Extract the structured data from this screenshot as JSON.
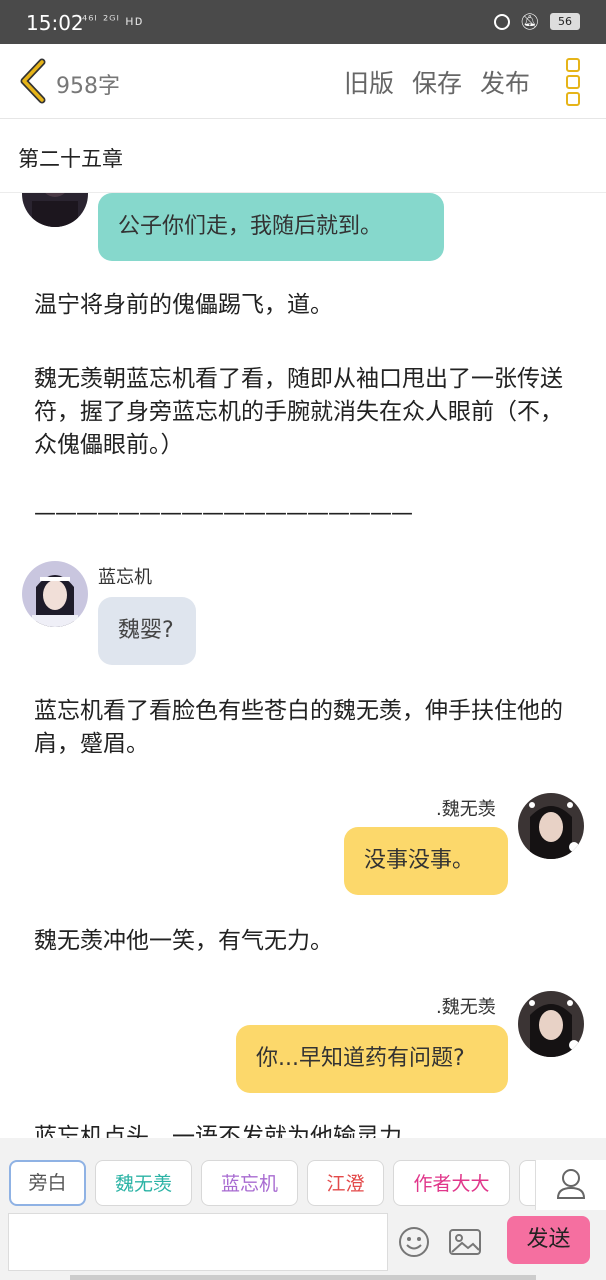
{
  "status_bar": {
    "time": "15:02",
    "signal_text": "⁴⁶ᴵ ²ᴳᴵ ʜᴅ",
    "battery": "56"
  },
  "topbar": {
    "word_count": "958字",
    "actions": [
      "旧版",
      "保存",
      "发布"
    ]
  },
  "chapter": {
    "title": "第二十五章"
  },
  "content": {
    "bubble_1": "公子你们走，我随后就到。",
    "para_1": "温宁将身前的傀儡踢飞，道。",
    "para_2": "魏无羡朝蓝忘机看了看，随即从袖口甩出了一张传送符，握了身旁蓝忘机的手腕就消失在众人眼前（不，众傀儡眼前。）",
    "divider": "——————————————————",
    "speaker_lan": "蓝忘机",
    "bubble_2": "魏婴?",
    "para_3": "蓝忘机看了看脸色有些苍白的魏无羡，伸手扶住他的肩，蹙眉。",
    "speaker_wei_1": ".魏无羡",
    "bubble_3": "没事没事。",
    "para_4": "魏无羡冲他一笑，有气无力。",
    "speaker_wei_2": ".魏无羡",
    "bubble_4": "你...早知道药有问题?",
    "para_5": "蓝忘机点头，一语不发就为他输灵力。"
  },
  "bottom": {
    "characters": [
      {
        "label": "旁白",
        "color": "#555555"
      },
      {
        "label": "魏无羡",
        "color": "#2bb3a5"
      },
      {
        "label": "蓝忘机",
        "color": "#a86bd1"
      },
      {
        "label": "江澄",
        "color": "#e34a4a"
      },
      {
        "label": "作者大大",
        "color": "#e0368a"
      }
    ],
    "send_label": "发送"
  },
  "colors": {
    "accent_yellow": "#e6b419",
    "teal_bubble": "#86d8cc",
    "gray_bubble": "#dfe5ee",
    "yellow_bubble": "#fcd86b",
    "send_pink": "#f56fa0"
  }
}
